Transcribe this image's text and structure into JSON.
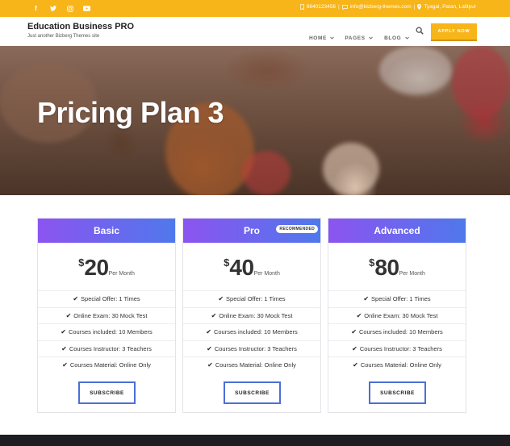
{
  "topbar": {
    "social_icons": [
      "facebook-icon",
      "twitter-icon",
      "instagram-icon",
      "youtube-icon"
    ],
    "phone": "9840123456",
    "email": "info@bizberg-themes.com",
    "address": "Tyagal, Patan, Lalitpur",
    "background": "#f7b51a"
  },
  "header": {
    "brand": "Education Business PRO",
    "tagline": "Just another Bizberg Themes site",
    "nav": [
      "HOME",
      "PAGES",
      "BLOG"
    ],
    "apply_label": "APPLY NOW"
  },
  "hero": {
    "title": "Pricing Plan 3"
  },
  "plans": [
    {
      "name": "Basic",
      "currency": "$",
      "amount": "20",
      "period": "Per Month",
      "badge": "",
      "features": [
        "Special Offer: 1 Times",
        "Online Exam: 30 Mock Test",
        "Courses included: 10 Members",
        "Courses Instructor: 3 Teachers",
        "Courses Material: Online Only"
      ],
      "button": "SUBSCRIBE"
    },
    {
      "name": "Pro",
      "currency": "$",
      "amount": "40",
      "period": "Per Month",
      "badge": "RECOMMENDED",
      "features": [
        "Special Offer: 1 Times",
        "Online Exam: 30 Mock Test",
        "Courses included: 10 Members",
        "Courses Instructor: 3 Teachers",
        "Courses Material: Online Only"
      ],
      "button": "SUBSCRIBE"
    },
    {
      "name": "Advanced",
      "currency": "$",
      "amount": "80",
      "period": "Per Month",
      "badge": "",
      "features": [
        "Special Offer: 1 Times",
        "Online Exam: 30 Mock Test",
        "Courses included: 10 Members",
        "Courses Instructor: 3 Teachers",
        "Courses Material: Online Only"
      ],
      "button": "SUBSCRIBE"
    }
  ],
  "colors": {
    "accent": "#f7b51a",
    "card_gradient_start": "#8c54f0",
    "card_gradient_end": "#4f78ec",
    "button_border": "#4a6fd8"
  }
}
